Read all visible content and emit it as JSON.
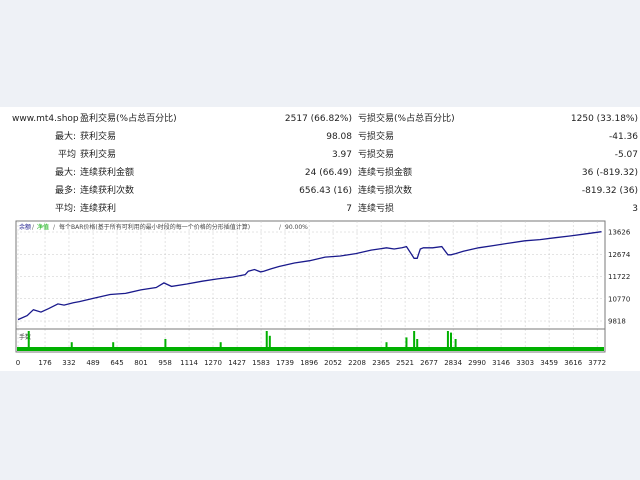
{
  "site": "www.mt4.shop",
  "stats": {
    "rows": [
      {
        "lbl1": "盈利交易(%占总百分比)",
        "val1": "2517 (66.82%)",
        "lbl2": "亏损交易(%占总百分比)",
        "val2": "1250 (33.18%)"
      },
      {
        "pre": "最大:",
        "lbl1": "获利交易",
        "val1": "98.08",
        "lbl2": "亏损交易",
        "val2": "-41.36"
      },
      {
        "pre": "平均",
        "lbl1": "获利交易",
        "val1": "3.97",
        "lbl2": "亏损交易",
        "val2": "-5.07"
      },
      {
        "pre": "最大:",
        "lbl1": "连续获利金额",
        "val1": "24 (66.49)",
        "lbl2": "连续亏损金额",
        "val2": "36 (-819.32)"
      },
      {
        "pre": "最多:",
        "lbl1": "连续获利次数",
        "val1": "656.43 (16)",
        "lbl2": "连续亏损次数",
        "val2": "-819.32 (36)"
      },
      {
        "pre": "平均:",
        "lbl1": "连续获利",
        "val1": "7",
        "lbl2": "连续亏损",
        "val2": "3"
      }
    ]
  },
  "chart": {
    "legend_balance": "余额",
    "legend_equity": "净值",
    "legend_desc": "每个BAR价格(基于所有可利用的最小时段的每一个价格的分形插值计算)",
    "legend_quality": "90.00%",
    "volume_label": "手数",
    "colors": {
      "balance": "#1a1a8c",
      "equity": "#00aa00",
      "volume": "#00b000",
      "grid": "#c8c8c8",
      "border": "#7a7a7a"
    }
  },
  "chart_data": {
    "type": "line",
    "series": [
      {
        "name": "余额",
        "color": "#1a1a8c",
        "x": [
          0,
          60,
          100,
          150,
          200,
          260,
          300,
          360,
          400,
          500,
          600,
          700,
          800,
          900,
          950,
          1000,
          1100,
          1200,
          1300,
          1400,
          1480,
          1500,
          1540,
          1580,
          1600,
          1650,
          1700,
          1800,
          1900,
          2000,
          2100,
          2200,
          2300,
          2350,
          2400,
          2450,
          2500,
          2530,
          2580,
          2600,
          2620,
          2640,
          2700,
          2760,
          2800,
          2820,
          2850,
          2900,
          3000,
          3100,
          3200,
          3300,
          3400,
          3500,
          3600,
          3700,
          3800
        ],
        "y": [
          9880,
          10050,
          10300,
          10200,
          10350,
          10550,
          10500,
          10600,
          10650,
          10800,
          10950,
          11000,
          11150,
          11250,
          11450,
          11300,
          11400,
          11520,
          11620,
          11700,
          11800,
          11950,
          12020,
          11920,
          11950,
          12050,
          12150,
          12300,
          12400,
          12550,
          12600,
          12700,
          12850,
          12900,
          12950,
          12900,
          12950,
          13000,
          12500,
          12500,
          12900,
          12950,
          12950,
          13000,
          12650,
          12650,
          12700,
          12800,
          12950,
          13050,
          13150,
          13250,
          13300,
          13380,
          13460,
          13550,
          13640
        ]
      },
      {
        "name": "净值",
        "color": "#00aa00"
      }
    ],
    "ylim": [
      9818,
      13626
    ],
    "xlim": [
      0,
      3810
    ],
    "y_ticks": [
      13626,
      12674,
      11722,
      10770,
      9818
    ],
    "x_ticks": [
      0,
      176,
      332,
      489,
      645,
      801,
      958,
      1114,
      1270,
      1427,
      1583,
      1739,
      1896,
      2052,
      2208,
      2365,
      2521,
      2677,
      2834,
      2990,
      3146,
      3303,
      3459,
      3616,
      3772
    ],
    "volume_spikes": [
      {
        "x": 70,
        "h": 1.0
      },
      {
        "x": 350,
        "h": 0.3
      },
      {
        "x": 620,
        "h": 0.3
      },
      {
        "x": 960,
        "h": 0.5
      },
      {
        "x": 1320,
        "h": 0.3
      },
      {
        "x": 1620,
        "h": 1.0
      },
      {
        "x": 1640,
        "h": 0.7
      },
      {
        "x": 2400,
        "h": 0.3
      },
      {
        "x": 2530,
        "h": 0.6
      },
      {
        "x": 2580,
        "h": 1.0
      },
      {
        "x": 2600,
        "h": 0.5
      },
      {
        "x": 2800,
        "h": 1.0
      },
      {
        "x": 2820,
        "h": 0.9
      },
      {
        "x": 2850,
        "h": 0.5
      }
    ],
    "grid": true
  }
}
